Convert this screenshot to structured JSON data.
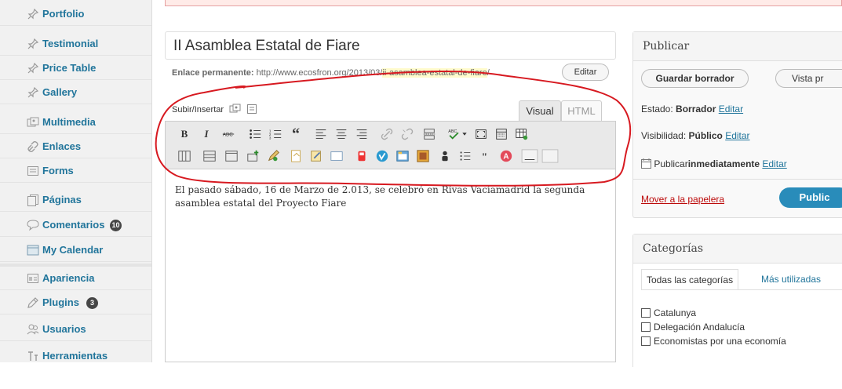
{
  "sidebar": {
    "items": [
      {
        "label": "Portfolio",
        "icon": "pin-icon"
      },
      {
        "label": "Testimonial",
        "icon": "pin-icon"
      },
      {
        "label": "Price Table",
        "icon": "pin-icon"
      },
      {
        "label": "Gallery",
        "icon": "pin-icon"
      },
      {
        "label": "Multimedia",
        "icon": "media-icon"
      },
      {
        "label": "Enlaces",
        "icon": "link-icon"
      },
      {
        "label": "Forms",
        "icon": "form-icon"
      },
      {
        "label": "Páginas",
        "icon": "pages-icon"
      },
      {
        "label": "Comentarios",
        "icon": "comment-icon",
        "badge": "10"
      },
      {
        "label": "My Calendar",
        "icon": "calendar-icon"
      },
      {
        "label": "Apariencia",
        "icon": "appearance-icon"
      },
      {
        "label": "Plugins",
        "icon": "plugin-icon",
        "badge": "3"
      },
      {
        "label": "Usuarios",
        "icon": "users-icon"
      },
      {
        "label": "Herramientas",
        "icon": "tools-icon"
      }
    ]
  },
  "post": {
    "title": "II Asamblea Estatal de Fiare",
    "permalink_label": "Enlace permanente:",
    "permalink_base": "http://www.ecosfron.org/2013/03/",
    "permalink_slug": "ii-asamblea-estatal-de-fiare",
    "permalink_end": "/",
    "permalink_edit": "Editar",
    "media_label": "Subir/Insertar",
    "tab_visual": "Visual",
    "tab_html": "HTML",
    "content": "El pasado sábado, 16 de Marzo de 2.013, se celebró en Rivas Vaciamadrid la segunda asamblea estatal del Proyecto Fiare"
  },
  "publish": {
    "title": "Publicar",
    "save_draft": "Guardar borrador",
    "preview": "Vista pr",
    "status_label": "Estado:",
    "status_value": "Borrador",
    "visibility_label": "Visibilidad:",
    "visibility_value": "Público",
    "schedule_label": "Publicar",
    "schedule_value": "inmediatamente",
    "edit": "Editar",
    "trash": "Mover a la papelera",
    "publish_button": "Public"
  },
  "categories": {
    "title": "Categorías",
    "tab_all": "Todas las categorías",
    "tab_popular": "Más utilizadas",
    "items": [
      "Catalunya",
      "Delegación Andalucía",
      "Economistas por una economía"
    ]
  },
  "toolbar": {
    "row1": [
      "bold-icon",
      "italic-icon",
      "strikethrough-icon",
      "bullet-list-icon",
      "numbered-list-icon",
      "blockquote-icon",
      "align-left-icon",
      "align-center-icon",
      "align-right-icon",
      "link-icon",
      "unlink-icon",
      "more-tag-icon",
      "spellcheck-icon",
      "fullscreen-icon",
      "kitchen-sink-icon",
      "table-icon"
    ],
    "row2": [
      "columns-icon",
      "layout-icon",
      "box-icon",
      "add-icon",
      "edit-icon",
      "doc-icon",
      "note-icon",
      "frame-icon",
      "youtube-icon",
      "vimeo-icon",
      "tabs-icon",
      "gallery-icon",
      "person-icon",
      "list-icon",
      "quote-icon",
      "circle-a-icon",
      "hr-icon",
      "blank-icon"
    ],
    "bold": "B",
    "italic": "I",
    "quote": "“"
  },
  "colors": {
    "link": "#21759b",
    "annotation": "#d71920",
    "publish": "#298cba",
    "trash": "#bc0b0b"
  }
}
